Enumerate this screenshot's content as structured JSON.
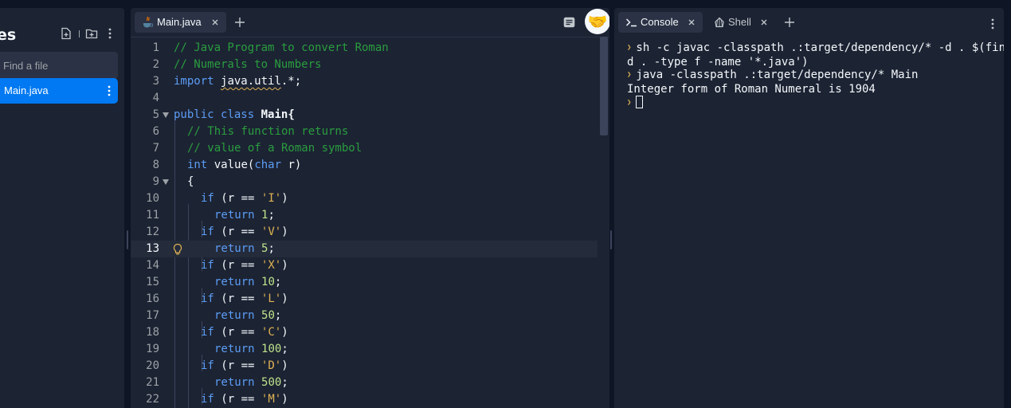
{
  "files_panel": {
    "title": "es",
    "search_placeholder": "Find a file",
    "items": [
      {
        "label": "Main.java",
        "selected": true
      }
    ]
  },
  "editor": {
    "tabs": [
      {
        "label": "Main.java",
        "active": true
      }
    ],
    "lines": [
      {
        "num": "1"
      },
      {
        "num": "2"
      },
      {
        "num": "3"
      },
      {
        "num": "4"
      },
      {
        "num": "5"
      },
      {
        "num": "6"
      },
      {
        "num": "7"
      },
      {
        "num": "8"
      },
      {
        "num": "9"
      },
      {
        "num": "10"
      },
      {
        "num": "11"
      },
      {
        "num": "12"
      },
      {
        "num": "13"
      },
      {
        "num": "14"
      },
      {
        "num": "15"
      },
      {
        "num": "16"
      },
      {
        "num": "17"
      },
      {
        "num": "18"
      },
      {
        "num": "19"
      },
      {
        "num": "20"
      },
      {
        "num": "21"
      },
      {
        "num": "22"
      }
    ],
    "code": {
      "c1": "// Java Program to convert Roman",
      "c2": "// Numerals to Numbers",
      "import_kw": "import",
      "import_pkg": "java.util",
      "import_rest": ".*;",
      "public_kw": "public",
      "class_kw": "class",
      "class_name": "Main{",
      "c6": "// This function returns",
      "c7": "// value of a Roman symbol",
      "int_kw": "int",
      "method_name": "value(",
      "char_kw": "char",
      "param": "r)",
      "brace": "{",
      "if_kw": "if",
      "return_kw": "return",
      "cond_open": "(r ==",
      "cond_close": ")",
      "sym_i": "'I'",
      "sym_v": "'V'",
      "sym_x": "'X'",
      "sym_l": "'L'",
      "sym_c": "'C'",
      "sym_d": "'D'",
      "sym_m": "'M'",
      "val_1": "1",
      "val_5": "5",
      "val_10": "10",
      "val_50": "50",
      "val_100": "100",
      "val_500": "500",
      "semi": ";"
    }
  },
  "console": {
    "tabs": [
      {
        "label": "Console",
        "active": true
      },
      {
        "label": "Shell",
        "active": false
      }
    ],
    "output": [
      "sh -c javac -classpath .:target/dependency/* -d . $(fin",
      "d . -type f -name '*.java')",
      "java -classpath .:target/dependency/* Main",
      "Integer form of Roman Numeral is 1904"
    ]
  },
  "icons": {
    "java": "java-file-icon",
    "close": "close-icon",
    "plus": "plus-icon",
    "new_file": "new-file-icon",
    "new_folder": "new-folder-icon",
    "kebab": "kebab-menu-icon",
    "avatar": "handshake-icon",
    "bulb": "lightbulb-icon",
    "console": "terminal-icon",
    "shell": "shell-icon",
    "format": "format-icon"
  },
  "colors": {
    "accent": "#0079f2",
    "panel": "#1c2333",
    "background": "#0e1525"
  }
}
